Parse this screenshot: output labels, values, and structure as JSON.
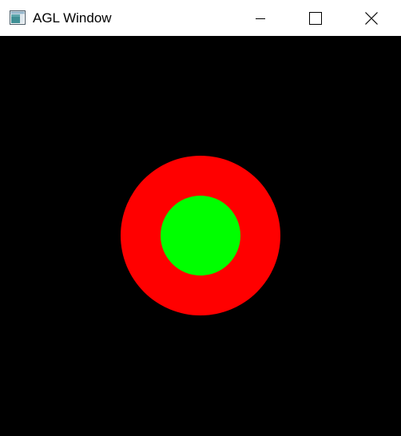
{
  "window": {
    "title": "AGL Window",
    "app_icon": "application-window-icon",
    "controls": {
      "minimize_icon": "minimize-icon",
      "maximize_icon": "maximize-icon",
      "close_icon": "close-icon"
    }
  },
  "canvas": {
    "background_color": "#000000",
    "outer_circle_color": "#ff0000",
    "inner_circle_color": "#00ff00"
  }
}
